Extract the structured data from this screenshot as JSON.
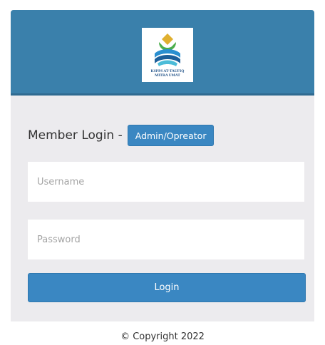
{
  "header": {
    "logo_text_line1": "KSPPS AT-TAUFIQ",
    "logo_text_line2": "MITRA UMAT"
  },
  "login": {
    "title": "Member Login -",
    "admin_button_label": "Admin/Opreator",
    "username_placeholder": "Username",
    "password_placeholder": "Password",
    "submit_label": "Login"
  },
  "footer": {
    "copyright": "© Copyright 2022"
  },
  "colors": {
    "header": "#3a80ab",
    "button": "#3a87c2",
    "panel": "#ecebee"
  }
}
